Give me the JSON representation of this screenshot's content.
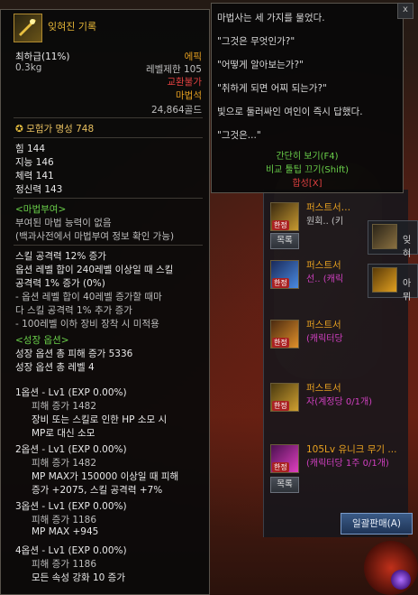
{
  "tooltip": {
    "title": "잊혀진 기록",
    "grade": "최하급(11%)",
    "rarity": "에픽",
    "weight": "0.3kg",
    "level_limit": "레벨제한 105",
    "trade": "교환불가",
    "type": "마법석",
    "price": "24,864골드",
    "fame": "모험가 명성 748",
    "stats": [
      "힘 144",
      "지능 146",
      "체력 141",
      "정신력 143"
    ],
    "enchant_header": "<마법부여>",
    "enchant_lines": [
      "부여된 마법 능력이 없음",
      "(백과사전에서 마법부여 정보 확인 가능)"
    ],
    "skill_lines": [
      "스킬 공격력 12% 증가",
      "옵션 레벨 합이 240레벨 이상일 때 스킬",
      "공격력 1% 증가 (0%)",
      "- 옵션 레벨 합이 40레벨 증가할 때마",
      "다 스킬 공격력 1% 추가 증가",
      "- 100레벨 이하 장비 장착 시 미적용"
    ],
    "growth_header": "<성장 옵션>",
    "growth_lines": [
      "성장 옵션 총 피해 증가 5336",
      "성장 옵션 총 레벨 4"
    ],
    "options": [
      {
        "head": "1옵션 - Lv1 (EXP 0.00%)",
        "lines": [
          "피해 증가 1482",
          "장비 또는 스킬로 인한 HP 소모 시",
          "MP로 대신 소모"
        ]
      },
      {
        "head": "2옵션 - Lv1 (EXP 0.00%)",
        "lines": [
          "피해 증가 1482",
          "MP MAX가 150000 이상일 때 피해",
          "증가 +2075, 스킬 공격력 +7%"
        ]
      },
      {
        "head": "3옵션 - Lv1 (EXP 0.00%)",
        "lines": [
          "피해 증가 1186",
          "MP MAX +945"
        ]
      },
      {
        "head": "4옵션 - Lv1 (EXP 0.00%)",
        "lines": [
          "피해 증가 1186",
          "모든 속성 강화 10 증가"
        ]
      }
    ]
  },
  "tip2": {
    "lines": [
      "마법사는 세 가지를 물었다.",
      "\"그것은 무엇인가?\"",
      "\"어떻게 알아보는가?\"",
      "\"취하게 되면 어찌 되는가?\"",
      "빛으로 둘러싸인 여인이 즉시 답했다.",
      "\"그것은...\""
    ],
    "option_view": "간단히 보기(F4)",
    "option_compare": "비교 툴팁 끄기(Shift)",
    "option_merge": "합성[X]",
    "close_label": "x"
  },
  "list": {
    "rows": [
      {
        "name": "퍼스트서…",
        "sub": "원회..  (키",
        "badge": "한정",
        "button": "목록"
      },
      {
        "name": "퍼스트서",
        "sub": "선..   (캐릭",
        "badge": "한정",
        "button": ""
      },
      {
        "name": "퍼스트서",
        "sub": "(캐릭터당",
        "badge": "한정",
        "button": ""
      },
      {
        "name": "퍼스트서",
        "sub": "자(계정당 0/1개)",
        "badge": "한정",
        "button": ""
      },
      {
        "name": "105Lv 유니크 무기 ...",
        "sub": "(캐릭터당 1주 0/1개)",
        "badge": "한정",
        "button": "목록"
      }
    ],
    "sale_button": "일괄판매(A)",
    "side_labels": [
      "잊혀",
      "아뮈"
    ],
    "top_buttons": [
      "목록"
    ]
  },
  "colors": {
    "gold": "#e8b838",
    "epic": "#e6a020",
    "green": "#6ad04a",
    "red": "#e04040",
    "magenta": "#d040c0"
  }
}
